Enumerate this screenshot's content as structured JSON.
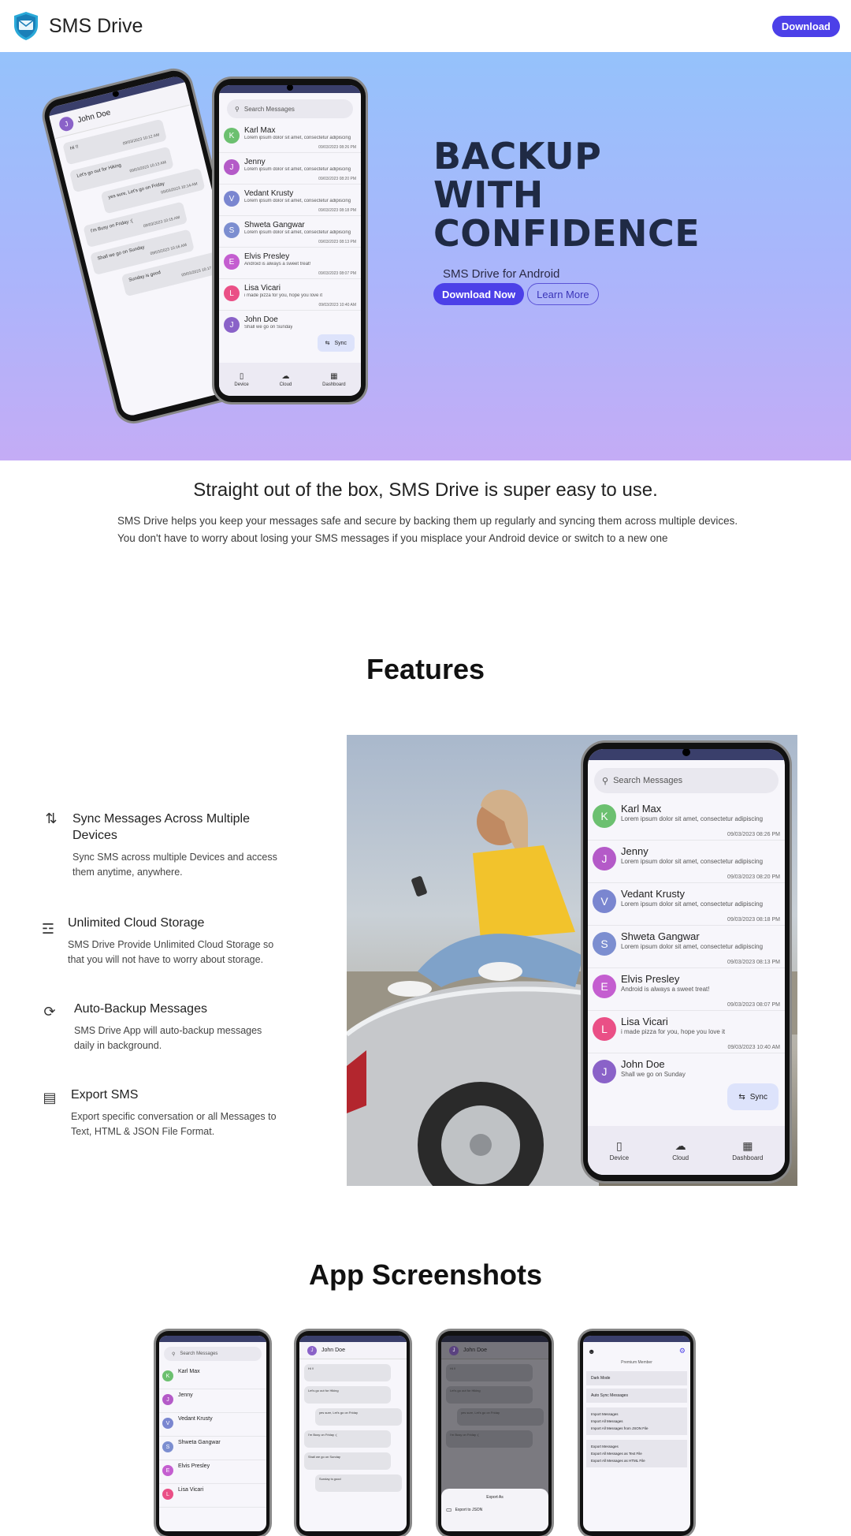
{
  "nav": {
    "brand": "SMS Drive",
    "download": "Download"
  },
  "hero": {
    "title_lines": [
      "BACKUP",
      "WITH",
      "CONFIDENCE"
    ],
    "subtitle": "SMS Drive for Android",
    "download_now": "Download Now",
    "learn_more": "Learn More"
  },
  "phone": {
    "search_placeholder": "Search Messages",
    "sync": "Sync",
    "nav": [
      "Device",
      "Cloud",
      "Dashboard"
    ],
    "contacts": [
      {
        "initial": "K",
        "name": "Karl Max",
        "preview": "Lorem ipsum dolor sit amet, consectetur adipiscing",
        "time": "09/03/2023 08:26 PM",
        "color": "#6cc070"
      },
      {
        "initial": "J",
        "name": "Jenny",
        "preview": "Lorem ipsum dolor sit amet, consectetur adipiscing",
        "time": "09/03/2023 08:20 PM",
        "color": "#b45ac8"
      },
      {
        "initial": "V",
        "name": "Vedant Krusty",
        "preview": "Lorem ipsum dolor sit amet, consectetur adipiscing",
        "time": "09/03/2023 08:18 PM",
        "color": "#7a86d0"
      },
      {
        "initial": "S",
        "name": "Shweta Gangwar",
        "preview": "Lorem ipsum dolor sit amet, consectetur adipiscing",
        "time": "09/03/2023 08:13 PM",
        "color": "#7c8ed0"
      },
      {
        "initial": "E",
        "name": "Elvis Presley",
        "preview": "Android is always a sweet treat!",
        "time": "09/03/2023 08:07 PM",
        "color": "#c45ed0"
      },
      {
        "initial": "L",
        "name": "Lisa Vicari",
        "preview": "i made pizza for you, hope you love it",
        "time": "09/03/2023 10:40 AM",
        "color": "#ea4f86"
      },
      {
        "initial": "J",
        "name": "John Doe",
        "preview": "Shall we go on Sunday",
        "time": "",
        "color": "#8a62c8"
      }
    ]
  },
  "chat": {
    "contact": "John Doe",
    "initial": "J",
    "messages": [
      {
        "text": "Hi !!",
        "time": "09/03/2023 10:12 AM"
      },
      {
        "text": "Let's go out for Hiking",
        "time": "09/03/2023 10:13 AM"
      },
      {
        "text": "yes sure, Let's go on Friday",
        "time": "09/03/2023 10:14 AM"
      },
      {
        "text": "I'm Busy on Friday :(",
        "time": "09/03/2023 10:15 AM"
      },
      {
        "text": "Shall we go on Sunday",
        "time": "09/03/2023 10:16 AM"
      },
      {
        "text": "Sunday is good",
        "time": "09/03/2023 10:17 AM"
      }
    ]
  },
  "intro": {
    "title": "Straight out of the box, SMS Drive is super easy to use.",
    "text": "SMS Drive helps you keep your messages safe and secure by backing them up regularly and syncing them across multiple devices. You don't have to worry about losing your SMS messages if you misplace your Android device or switch to a new one"
  },
  "features": {
    "title": "Features",
    "items": [
      {
        "icon": "sync-devices-icon",
        "title": "Sync Messages Across Multiple Devices",
        "desc": "Sync SMS across multiple Devices and access them anytime, anywhere."
      },
      {
        "icon": "database-icon",
        "title": "Unlimited Cloud Storage",
        "desc": "SMS Drive Provide Unlimited Cloud Storage so that you will not have to worry about storage."
      },
      {
        "icon": "auto-backup-icon",
        "title": "Auto-Backup Messages",
        "desc": "SMS Drive App will auto-backup messages daily in background."
      },
      {
        "icon": "export-icon",
        "title": "Export SMS",
        "desc": "Export specific conversation or all Messages to Text, HTML & JSON File Format."
      }
    ]
  },
  "screenshots": {
    "title": "App Screenshots",
    "export_label": "Export As",
    "export_json": "Export to JSON",
    "premium": "Premium Member",
    "settings_items": [
      "Dark Mode",
      "Auto Sync Messages",
      "Import Messages",
      "Import All Messages",
      "Import All Messages from JSON File",
      "Export Messages",
      "Export All Messages as Text File",
      "Export All Messages as HTML File"
    ]
  },
  "colors": {
    "accent": "#4c40e8",
    "title": "#1f2a44",
    "hero_top": "#95c2fb",
    "hero_bottom": "#c4acf6"
  }
}
